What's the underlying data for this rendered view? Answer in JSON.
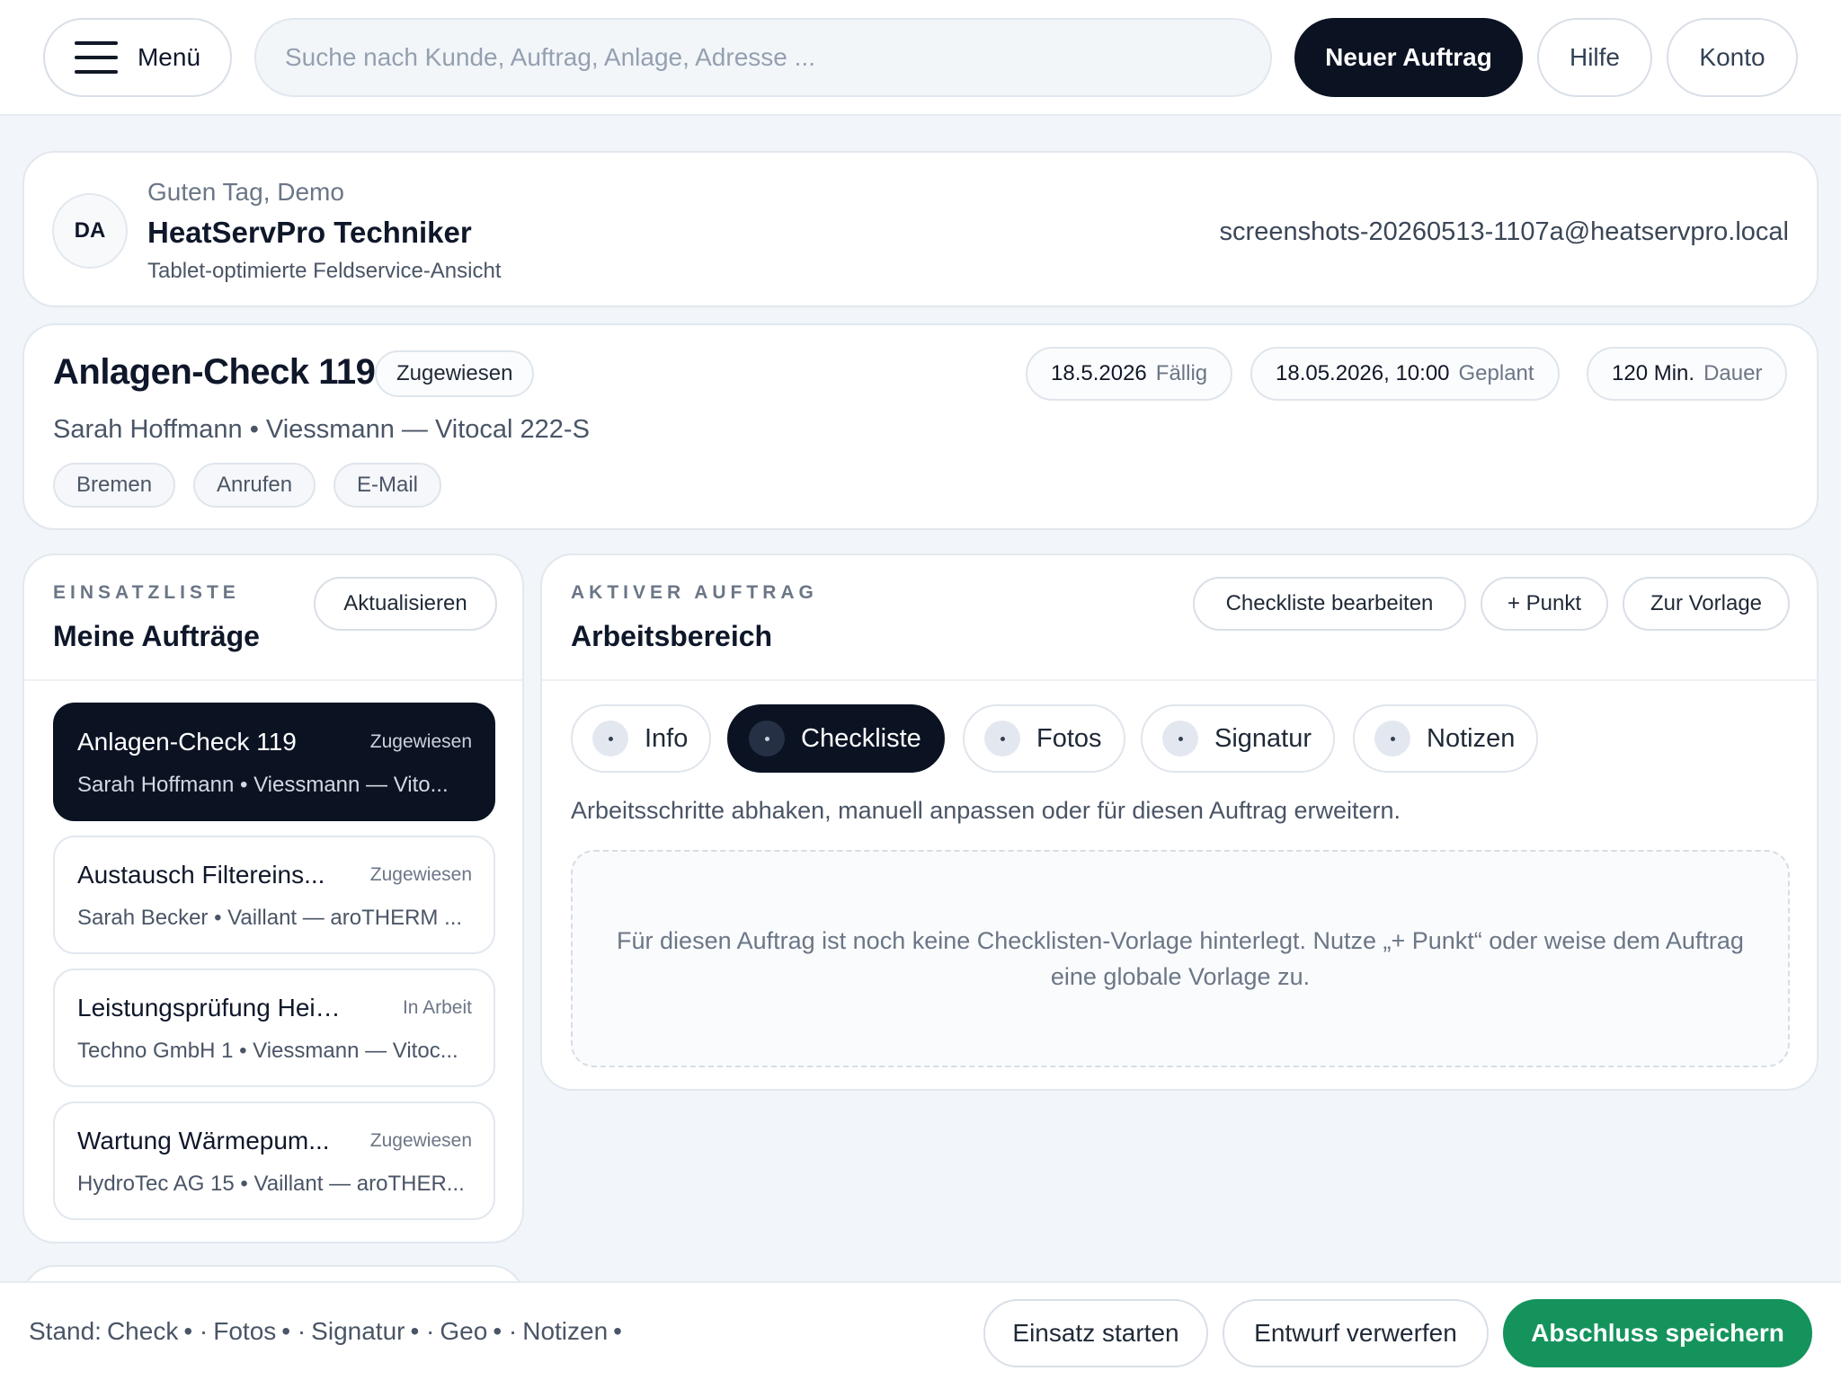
{
  "header": {
    "menu_label": "Menü",
    "search_placeholder": "Suche nach Kunde, Auftrag, Anlage, Adresse ...",
    "new_order_label": "Neuer Auftrag",
    "help_label": "Hilfe",
    "account_label": "Konto"
  },
  "profile": {
    "initials": "DA",
    "greeting": "Guten Tag, Demo",
    "title": "HeatServPro Techniker",
    "subtitle": "Tablet-optimierte Feldservice-Ansicht",
    "email": "screenshots-20260513-1107a@heatservpro.local"
  },
  "order": {
    "title": "Anlagen-Check 119",
    "status": "Zugewiesen",
    "due_value": "18.5.2026",
    "due_label": "Fällig",
    "planned_value": "18.05.2026, 10:00",
    "planned_label": "Geplant",
    "duration_value": "120 Min.",
    "duration_label": "Dauer",
    "subtitle": "Sarah Hoffmann • Viessmann — Vitocal 222-S",
    "chips": [
      "Bremen",
      "Anrufen",
      "E-Mail"
    ]
  },
  "job_list": {
    "eyebrow": "EINSATZLISTE",
    "title": "Meine Aufträge",
    "refresh_label": "Aktualisieren",
    "items": [
      {
        "title": "Anlagen-Check 119",
        "status": "Zugewiesen",
        "sub": "Sarah Hoffmann • Viessmann — Vito..."
      },
      {
        "title": "Austausch Filtereins...",
        "status": "Zugewiesen",
        "sub": "Sarah Becker • Vaillant — aroTHERM ..."
      },
      {
        "title": "Leistungsprüfung Heiz...",
        "status": "In Arbeit",
        "sub": "Techno GmbH 1 • Viessmann — Vitoc..."
      },
      {
        "title": "Wartung Wärmepum...",
        "status": "Zugewiesen",
        "sub": "HydroTec AG 15 • Vaillant — aroTHER..."
      }
    ]
  },
  "workspace": {
    "eyebrow": "AKTIVER AUFTRAG",
    "title": "Arbeitsbereich",
    "edit_checklist_label": "Checkliste bearbeiten",
    "add_point_label": "+ Punkt",
    "template_label": "Zur Vorlage",
    "tabs": [
      "Info",
      "Checkliste",
      "Fotos",
      "Signatur",
      "Notizen"
    ],
    "active_tab": "Checkliste",
    "description": "Arbeitsschritte abhaken, manuell anpassen oder für diesen Auftrag erweitern.",
    "empty_message": "Für diesen Auftrag ist noch keine Checklisten-Vorlage hinterlegt. Nutze „+ Punkt“ oder weise dem Auftrag eine globale Vorlage zu."
  },
  "footer": {
    "status_prefix": "Stand:",
    "status_items": [
      "Check",
      "Fotos",
      "Signatur",
      "Geo",
      "Notizen"
    ],
    "start_label": "Einsatz starten",
    "discard_label": "Entwurf verwerfen",
    "save_label": "Abschluss speichern"
  },
  "colors": {
    "primary_dark": "#0b1323",
    "success": "#15935d",
    "background": "#f2f5f9"
  }
}
